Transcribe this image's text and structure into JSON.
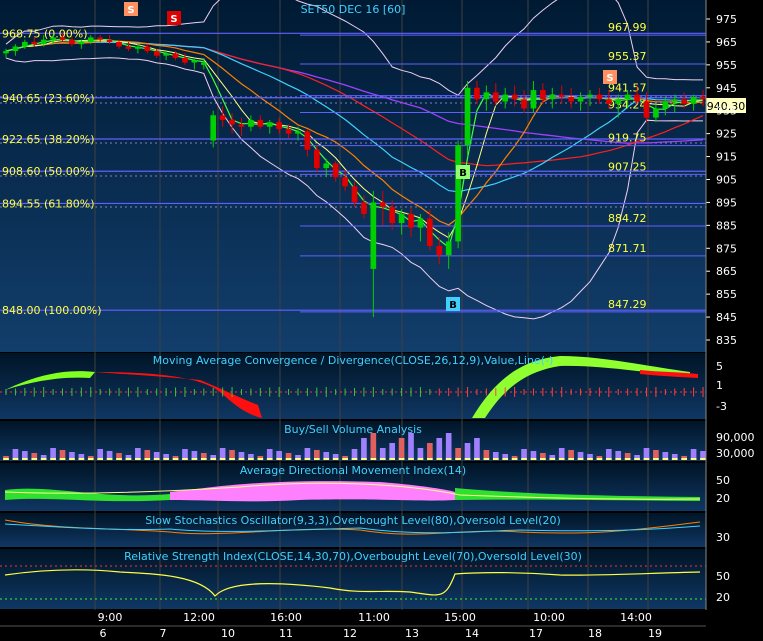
{
  "chart_data": {
    "type": "candlestick",
    "title": "SET50 DEC 16  [60]",
    "last_price": "940.30",
    "y_ticks": [
      975,
      965,
      955,
      945,
      935,
      925,
      915,
      905,
      895,
      885,
      875,
      865,
      855,
      845,
      835
    ],
    "fibonacci": [
      {
        "label": "968.75 (0.00%)",
        "value": 968.75
      },
      {
        "label": "940.65 (23.60%)",
        "value": 940.65
      },
      {
        "label": "922.65 (38.20%)",
        "value": 922.65
      },
      {
        "label": "908.60 (50.00%)",
        "value": 908.6
      },
      {
        "label": "894.55 (61.80%)",
        "value": 894.55
      },
      {
        "label": "848.00 (100.00%)",
        "value": 848.0
      }
    ],
    "levels": [
      {
        "label": "967.99",
        "value": 967.99
      },
      {
        "label": "955.37",
        "value": 955.37
      },
      {
        "label": "941.57",
        "value": 941.57
      },
      {
        "label": "934.24",
        "value": 934.24
      },
      {
        "label": "919.75",
        "value": 919.75
      },
      {
        "label": "907.25",
        "value": 907.25
      },
      {
        "label": "884.72",
        "value": 884.72
      },
      {
        "label": "871.71",
        "value": 871.71
      },
      {
        "label": "847.29",
        "value": 847.29
      }
    ],
    "candles": [
      [
        960,
        962,
        958,
        961
      ],
      [
        961,
        964,
        959,
        963
      ],
      [
        963,
        966,
        962,
        965
      ],
      [
        965,
        967,
        963,
        964
      ],
      [
        964,
        968,
        963,
        966
      ],
      [
        966,
        968,
        964,
        967
      ],
      [
        967,
        969,
        965,
        966
      ],
      [
        966,
        967,
        963,
        964
      ],
      [
        964,
        966,
        962,
        965
      ],
      [
        965,
        968,
        964,
        967
      ],
      [
        967,
        968,
        965,
        966
      ],
      [
        966,
        968,
        964,
        965
      ],
      [
        965,
        966,
        962,
        963
      ],
      [
        963,
        965,
        961,
        962
      ],
      [
        962,
        964,
        960,
        963
      ],
      [
        963,
        964,
        960,
        961
      ],
      [
        961,
        962,
        958,
        959
      ],
      [
        959,
        961,
        957,
        960
      ],
      [
        960,
        961,
        957,
        958
      ],
      [
        958,
        960,
        955,
        956
      ],
      [
        956,
        958,
        953,
        957
      ],
      [
        955,
        958,
        953,
        956
      ],
      [
        922,
        935,
        919,
        933
      ],
      [
        933,
        937,
        928,
        931
      ],
      [
        931,
        934,
        925,
        929
      ],
      [
        929,
        932,
        924,
        928
      ],
      [
        928,
        933,
        926,
        931
      ],
      [
        931,
        933,
        927,
        928
      ],
      [
        928,
        931,
        925,
        930
      ],
      [
        930,
        932,
        925,
        927
      ],
      [
        927,
        929,
        923,
        925
      ],
      [
        925,
        928,
        922,
        926
      ],
      [
        926,
        927,
        915,
        918
      ],
      [
        918,
        920,
        908,
        910
      ],
      [
        910,
        914,
        906,
        912
      ],
      [
        912,
        913,
        904,
        906
      ],
      [
        906,
        909,
        900,
        902
      ],
      [
        902,
        904,
        893,
        895
      ],
      [
        895,
        898,
        888,
        890
      ],
      [
        866,
        900,
        845,
        895
      ],
      [
        895,
        900,
        885,
        893
      ],
      [
        893,
        896,
        883,
        886
      ],
      [
        886,
        892,
        881,
        890
      ],
      [
        890,
        893,
        880,
        884
      ],
      [
        884,
        890,
        878,
        888
      ],
      [
        888,
        892,
        874,
        876
      ],
      [
        876,
        880,
        868,
        872
      ],
      [
        872,
        882,
        866,
        878
      ],
      [
        878,
        922,
        875,
        920
      ],
      [
        920,
        948,
        915,
        945
      ],
      [
        945,
        948,
        938,
        940
      ],
      [
        940,
        946,
        935,
        943
      ],
      [
        943,
        947,
        937,
        939
      ],
      [
        939,
        945,
        936,
        942
      ],
      [
        942,
        946,
        937,
        940
      ],
      [
        940,
        944,
        934,
        936
      ],
      [
        936,
        948,
        934,
        944
      ],
      [
        944,
        947,
        938,
        940
      ],
      [
        940,
        945,
        936,
        942
      ],
      [
        942,
        946,
        938,
        941
      ],
      [
        941,
        945,
        936,
        939
      ],
      [
        939,
        943,
        935,
        941
      ],
      [
        941,
        944,
        937,
        942
      ],
      [
        942,
        945,
        938,
        940
      ],
      [
        940,
        944,
        936,
        938
      ],
      [
        938,
        942,
        932,
        940
      ],
      [
        940,
        944,
        936,
        942
      ],
      [
        942,
        946,
        938,
        939
      ],
      [
        939,
        943,
        930,
        932
      ],
      [
        932,
        938,
        930,
        936
      ],
      [
        936,
        941,
        933,
        939
      ],
      [
        939,
        942,
        934,
        940
      ],
      [
        940,
        943,
        936,
        938
      ],
      [
        938,
        942,
        935,
        941
      ],
      [
        941,
        944,
        937,
        940
      ]
    ],
    "marker_texts": {
      "s": "S",
      "b": "B"
    },
    "x_ticks": {
      "times": [
        "9:00",
        "12:00",
        "16:00",
        "11:00",
        "15:00",
        "10:00",
        "14:00"
      ],
      "dates": [
        "6",
        "7",
        "10",
        "11",
        "12",
        "13",
        "14",
        "17",
        "18",
        "19"
      ]
    },
    "panels": {
      "macd": {
        "title": "Moving Average Convergence / Divergence(CLOSE,26,12,9),Value,Line(-)",
        "ticks": [
          "5",
          "1",
          "-3"
        ]
      },
      "volume": {
        "title": "Buy/Sell Volume Analysis",
        "ticks": [
          "90,000",
          "30,000"
        ]
      },
      "adx": {
        "title": "Average Directional Movement Index(14)",
        "ticks": [
          "50",
          "20"
        ]
      },
      "stoch": {
        "title": "Slow Stochastics Oscillator(9,3,3),Overbought Level(80),Oversold Level(20)",
        "ticks": [
          "30"
        ]
      },
      "rsi": {
        "title": "Relative Strength Index(CLOSE,14,30,70),Overbought Level(70),Oversold Level(30)",
        "ticks": [
          "50",
          "20"
        ]
      }
    }
  },
  "colors": {
    "up": "#00d000",
    "down": "#e00000",
    "fib": "#6060ff",
    "grid": "#ffffff",
    "bb": "#f0d0f0",
    "ma_green": "#40ff40",
    "ma_orange": "#ff8000",
    "ma_cyan": "#40d0ff",
    "ma_purple": "#a040ff",
    "ma_red": "#ff2020",
    "ma_yellow": "#ffff80"
  }
}
